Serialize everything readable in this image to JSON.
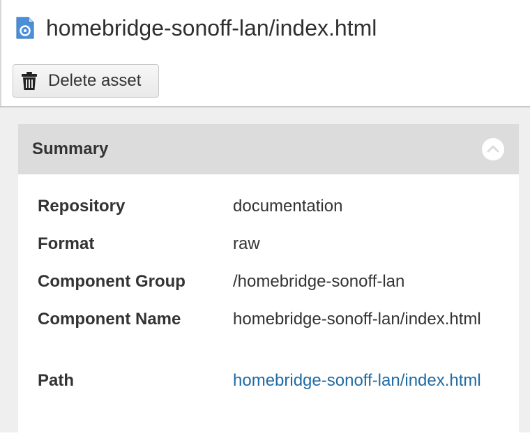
{
  "asset": {
    "title": "homebridge-sonoff-lan/index.html",
    "icon": "file-icon"
  },
  "toolbar": {
    "delete_label": "Delete asset",
    "delete_icon": "trash-icon"
  },
  "summary": {
    "title": "Summary",
    "collapse_icon": "chevron-up-circle-icon",
    "rows": [
      {
        "label": "Repository",
        "value": "documentation"
      },
      {
        "label": "Format",
        "value": "raw"
      },
      {
        "label": "Component Group",
        "value": "/homebridge-sonoff-lan"
      },
      {
        "label": "Component Name",
        "value": "homebridge-sonoff-lan/index.html"
      },
      {
        "label": "Path",
        "value": "homebridge-sonoff-lan/index.html"
      }
    ]
  },
  "colors": {
    "link": "#1f6ba4",
    "header_bg": "#dcdcdc",
    "icon_blue": "#4a90d9"
  }
}
